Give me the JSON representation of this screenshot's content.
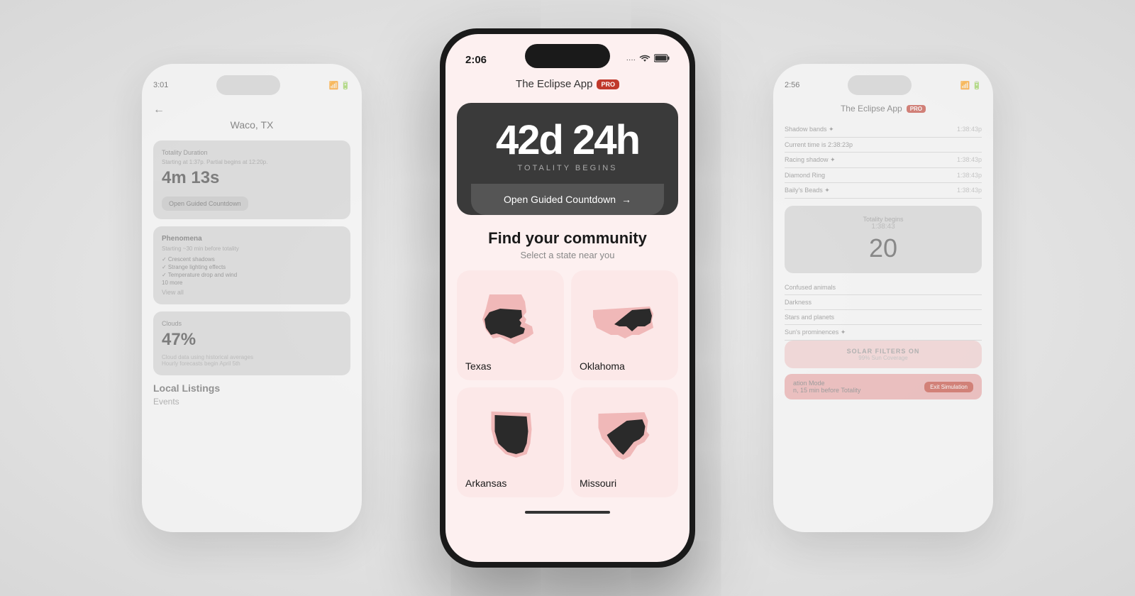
{
  "background": {
    "color": "#e0e0e0"
  },
  "phone_left": {
    "status_time": "3:01",
    "back_label": "←",
    "location": "Waco, TX",
    "totality_card": {
      "label": "Totality Duration",
      "sub": "Starting at 1:37p. Partial begins at 12:20p.",
      "value": "4m 13s",
      "button": "Open Guided Countdown"
    },
    "phenomena_card": {
      "title": "Phenomena",
      "sub": "Starting ~30 min before totality",
      "items": [
        "✓ Crescent shadows",
        "✓ Strange lighting effects",
        "✓ Temperature drop and wind",
        "10 more"
      ],
      "link": "View all"
    },
    "clouds_card": {
      "label": "Clouds",
      "value": "47%",
      "sub": "Cloud data using historical averages",
      "sub2": "Hourly forecasts begin April 5th"
    },
    "local_listings": "Local Listings",
    "events": "Events"
  },
  "phone_center": {
    "status_time": "2:06",
    "app_title": "The Eclipse App",
    "pro_label": "PRO",
    "countdown": {
      "value": "42d 24h",
      "label": "TOTALITY BEGINS",
      "button": "Open Guided Countdown",
      "arrow": "→"
    },
    "community": {
      "title": "Find your community",
      "subtitle": "Select a state near you",
      "states": [
        {
          "name": "Texas",
          "id": "texas"
        },
        {
          "name": "Oklahoma",
          "id": "oklahoma"
        },
        {
          "name": "Arkansas",
          "id": "arkansas"
        },
        {
          "name": "Missouri",
          "id": "missouri"
        }
      ]
    }
  },
  "phone_right": {
    "status_time": "2:56",
    "app_title": "The Eclipse App",
    "pro_label": "PRO",
    "phenomena": [
      {
        "label": "Shadow bands ✦",
        "value": "1:38:43p"
      },
      {
        "label": "Current time is 2:38:23p",
        "value": ""
      },
      {
        "label": "Racing shadow ✦",
        "value": "1:38:43p"
      },
      {
        "label": "Diamond Ring",
        "value": "1:38:43p"
      },
      {
        "label": "Baily's Beads ✦",
        "value": "1:38:43p"
      }
    ],
    "totality_card": {
      "label": "Totality begins",
      "time": "1:38:43",
      "value": "20"
    },
    "more_items": [
      {
        "label": "Confused animals",
        "value": ""
      },
      {
        "label": "Darkness",
        "value": ""
      },
      {
        "label": "Stars and planets",
        "value": ""
      },
      {
        "label": "Sun's prominences ✦",
        "value": ""
      }
    ],
    "solar_filters": "SOLAR FILTERS ON",
    "solar_sub": "99% Sun Coverage",
    "simulation": {
      "label": "ation Mode",
      "sub": "n, 15 min before Totality",
      "exit": "Exit Simulation"
    }
  }
}
